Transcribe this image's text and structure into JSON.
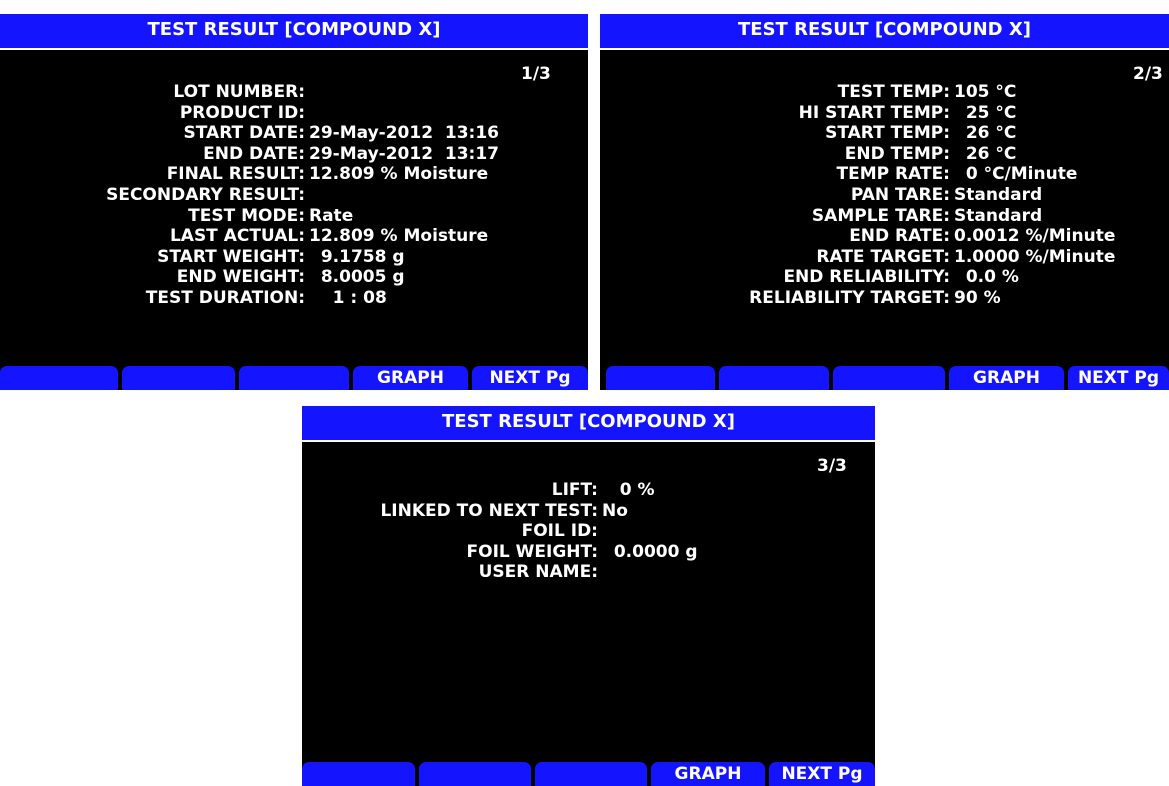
{
  "caption": "",
  "screens": [
    {
      "title": "TEST RESULT [COMPOUND X]",
      "page": "1/3",
      "fields": [
        {
          "label": "LOT NUMBER:",
          "value": ""
        },
        {
          "label": "PRODUCT ID:",
          "value": ""
        },
        {
          "label": "START DATE:",
          "value": "29-May-2012  13:16"
        },
        {
          "label": "END DATE:",
          "value": "29-May-2012  13:17"
        },
        {
          "label": "FINAL RESULT:",
          "value": "12.809 % Moisture"
        },
        {
          "label": "SECONDARY RESULT:",
          "value": ""
        },
        {
          "label": "TEST MODE:",
          "value": "Rate"
        },
        {
          "label": "LAST ACTUAL:",
          "value": "12.809 % Moisture"
        },
        {
          "label": "START WEIGHT:",
          "value": "  9.1758 g"
        },
        {
          "label": "END WEIGHT:",
          "value": "  8.0005 g"
        },
        {
          "label": "TEST DURATION:",
          "value": "    1 : 08"
        }
      ],
      "softkeys": [
        "",
        "",
        "",
        "GRAPH",
        "NEXT Pg"
      ]
    },
    {
      "title": "TEST RESULT [COMPOUND X]",
      "page": "2/3",
      "fields": [
        {
          "label": "TEST TEMP:",
          "value": "105 °C"
        },
        {
          "label": "HI START TEMP:",
          "value": "  25 °C"
        },
        {
          "label": "START TEMP:",
          "value": "  26 °C"
        },
        {
          "label": "END TEMP:",
          "value": "  26 °C"
        },
        {
          "label": "TEMP RATE:",
          "value": "  0 °C/Minute"
        },
        {
          "label": "PAN TARE:",
          "value": "Standard"
        },
        {
          "label": "SAMPLE TARE:",
          "value": "Standard"
        },
        {
          "label": "END RATE:",
          "value": "0.0012 %/Minute"
        },
        {
          "label": "RATE TARGET:",
          "value": "1.0000 %/Minute"
        },
        {
          "label": "END RELIABILITY:",
          "value": "  0.0 %"
        },
        {
          "label": "RELIABILITY TARGET:",
          "value": "90 %"
        }
      ],
      "softkeys": [
        "",
        "",
        "",
        "GRAPH",
        "NEXT Pg"
      ]
    },
    {
      "title": "TEST RESULT [COMPOUND X]",
      "page": "3/3",
      "fields": [
        {
          "label": "LIFT:",
          "value": "   0 %"
        },
        {
          "label": "LINKED TO NEXT TEST:",
          "value": "No"
        },
        {
          "label": "FOIL ID:",
          "value": ""
        },
        {
          "label": "FOIL WEIGHT:",
          "value": "  0.0000 g"
        },
        {
          "label": "USER NAME:",
          "value": ""
        }
      ],
      "softkeys": [
        "",
        "",
        "",
        "GRAPH",
        "NEXT Pg"
      ]
    }
  ]
}
